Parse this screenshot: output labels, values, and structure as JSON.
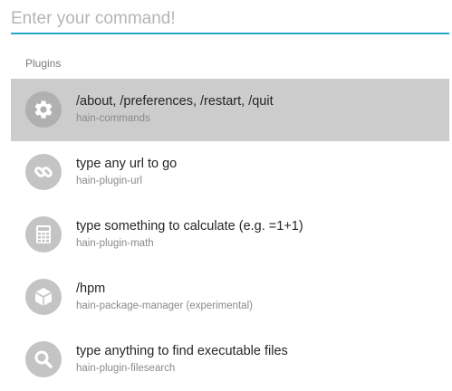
{
  "search": {
    "value": "",
    "placeholder": "Enter your command!"
  },
  "section": {
    "title": "Plugins"
  },
  "results": [
    {
      "title": "/about, /preferences, /restart, /quit",
      "subtitle": "hain-commands",
      "icon": "gear-icon",
      "selected": true
    },
    {
      "title": "type any url to go",
      "subtitle": "hain-plugin-url",
      "icon": "link-icon",
      "selected": false
    },
    {
      "title": "type something to calculate (e.g. =1+1)",
      "subtitle": "hain-plugin-math",
      "icon": "calculator-icon",
      "selected": false
    },
    {
      "title": "/hpm",
      "subtitle": "hain-package-manager (experimental)",
      "icon": "package-icon",
      "selected": false
    },
    {
      "title": "type anything to find executable files",
      "subtitle": "hain-plugin-filesearch",
      "icon": "search-icon",
      "selected": false
    }
  ],
  "colors": {
    "accent": "#26a9c6",
    "selected_background": "#cccccc",
    "icon_circle": "#c4c4c4",
    "icon_glyph": "#ffffff"
  }
}
